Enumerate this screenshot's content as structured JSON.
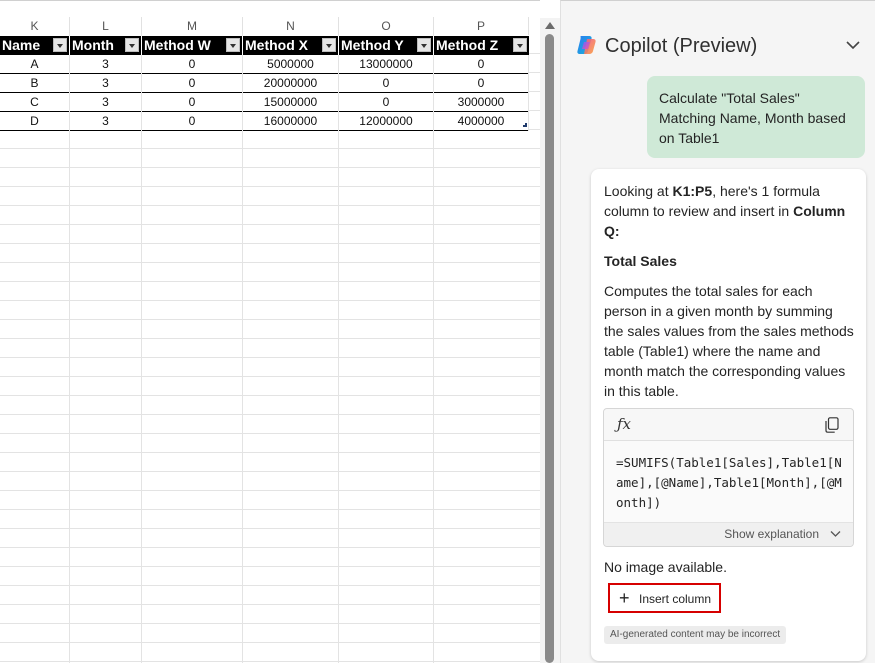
{
  "sheet": {
    "column_letters": [
      "K",
      "L",
      "M",
      "N",
      "O",
      "P"
    ],
    "headers": [
      "Name",
      "Month",
      "Method W",
      "Method X",
      "Method Y",
      "Method Z"
    ],
    "rows": [
      [
        "A",
        "3",
        "0",
        "5000000",
        "13000000",
        "0"
      ],
      [
        "B",
        "3",
        "0",
        "20000000",
        "0",
        "0"
      ],
      [
        "C",
        "3",
        "0",
        "15000000",
        "0",
        "3000000"
      ],
      [
        "D",
        "3",
        "0",
        "16000000",
        "12000000",
        "4000000"
      ]
    ]
  },
  "copilot": {
    "title": "Copilot (Preview)",
    "user_message": "Calculate \"Total Sales\" Matching Name, Month based on Table1",
    "reply": {
      "intro_prefix": "Looking at ",
      "range": "K1:P5",
      "intro_middle": ", here's 1 formula column to review and insert in ",
      "target_column": "Column Q",
      "intro_suffix": ":",
      "section_title": "Total Sales",
      "description": "Computes the total sales for each person in a given month by summing the sales values from the sales methods table (Table1) where the name and month match the corresponding values in this table.",
      "formula": "=SUMIFS(Table1[Sales],Table1[Name],[@Name],Table1[Month],[@Month])",
      "show_explanation": "Show explanation",
      "no_image": "No image available.",
      "insert_button": "Insert column",
      "ai_notice": "AI-generated content may be incorrect"
    },
    "icons": {
      "logo": "copilot-logo-icon",
      "collapse": "chevron-down-icon",
      "fx": "fx-icon",
      "copy": "copy-icon",
      "plus": "plus-icon"
    },
    "colors": {
      "user_bubble": "#cfe9d7",
      "insert_highlight": "#d60000"
    }
  }
}
